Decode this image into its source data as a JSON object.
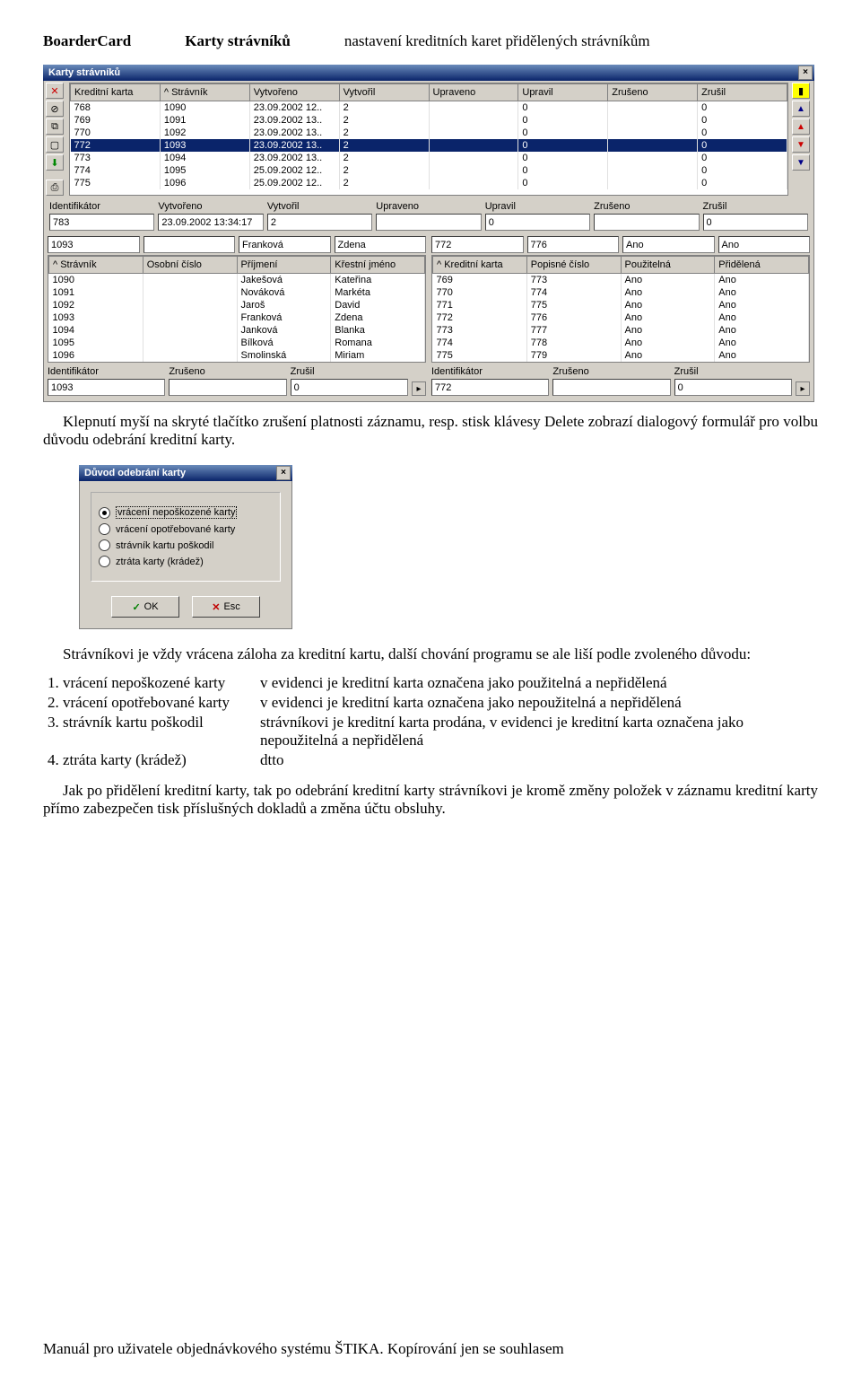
{
  "header": {
    "col1": "BoarderCard",
    "col2": "Karty strávníků",
    "col3": "nastavení kreditních karet přidělených strávníkům"
  },
  "mainWin": {
    "title": "Karty strávníků",
    "cols": [
      "Kreditní karta",
      "^ Strávník",
      "Vytvořeno",
      "Vytvořil",
      "Upraveno",
      "Upravil",
      "Zrušeno",
      "Zrušil"
    ],
    "rows": [
      [
        "768",
        "1090",
        "23.09.2002 12..",
        "2",
        "",
        "0",
        "",
        "0"
      ],
      [
        "769",
        "1091",
        "23.09.2002 13..",
        "2",
        "",
        "0",
        "",
        "0"
      ],
      [
        "770",
        "1092",
        "23.09.2002 13..",
        "2",
        "",
        "0",
        "",
        "0"
      ],
      [
        "772",
        "1093",
        "23.09.2002 13..",
        "2",
        "",
        "0",
        "",
        "0"
      ],
      [
        "773",
        "1094",
        "23.09.2002 13..",
        "2",
        "",
        "0",
        "",
        "0"
      ],
      [
        "774",
        "1095",
        "25.09.2002 12..",
        "2",
        "",
        "0",
        "",
        "0"
      ],
      [
        "775",
        "1096",
        "25.09.2002 12..",
        "2",
        "",
        "0",
        "",
        "0"
      ]
    ],
    "selIdx": 3,
    "form": {
      "labels": [
        "Identifikátor",
        "Vytvořeno",
        "Vytvořil",
        "Upraveno",
        "Upravil",
        "Zrušeno",
        "Zrušil"
      ],
      "vals": [
        "783",
        "23.09.2002 13:34:17",
        "2",
        "",
        "0",
        "",
        "0"
      ]
    },
    "left": {
      "top": [
        "1093",
        "",
        "Franková",
        "Zdena"
      ],
      "cols": [
        "^ Strávník",
        "Osobní číslo",
        "Příjmení",
        "Křestní jméno"
      ],
      "rows": [
        [
          "1090",
          "",
          "Jakešová",
          "Kateřina"
        ],
        [
          "1091",
          "",
          "Nováková",
          "Markéta"
        ],
        [
          "1092",
          "",
          "Jaroš",
          "David"
        ],
        [
          "1093",
          "",
          "Franková",
          "Zdena"
        ],
        [
          "1094",
          "",
          "Janková",
          "Blanka"
        ],
        [
          "1095",
          "",
          "Bílková",
          "Romana"
        ],
        [
          "1096",
          "",
          "Smolinská",
          "Miriam"
        ]
      ],
      "bottom": {
        "labels": [
          "Identifikátor",
          "Zrušeno",
          "Zrušil"
        ],
        "vals": [
          "1093",
          "",
          "0"
        ]
      }
    },
    "right": {
      "top": [
        "772",
        "776",
        "Ano",
        "Ano"
      ],
      "cols": [
        "^ Kreditní karta",
        "Popisné číslo",
        "Použitelná",
        "Přidělená"
      ],
      "rows": [
        [
          "769",
          "773",
          "Ano",
          "Ano"
        ],
        [
          "770",
          "774",
          "Ano",
          "Ano"
        ],
        [
          "771",
          "775",
          "Ano",
          "Ano"
        ],
        [
          "772",
          "776",
          "Ano",
          "Ano"
        ],
        [
          "773",
          "777",
          "Ano",
          "Ano"
        ],
        [
          "774",
          "778",
          "Ano",
          "Ano"
        ],
        [
          "775",
          "779",
          "Ano",
          "Ano"
        ]
      ],
      "bottom": {
        "labels": [
          "Identifikátor",
          "Zrušeno",
          "Zrušil"
        ],
        "vals": [
          "772",
          "",
          "0"
        ]
      }
    }
  },
  "para1": "Klepnutí myší na skryté tlačítko zrušení platnosti záznamu, resp. stisk klávesy Delete zobrazí dialogový formulář pro volbu důvodu odebrání kreditní karty.",
  "dialog": {
    "title": "Důvod odebrání karty",
    "options": [
      "vrácení nepoškozené karty",
      "vrácení opotřebované karty",
      "strávník kartu poškodil",
      "ztráta karty (krádež)"
    ],
    "ok": "OK",
    "esc": "Esc"
  },
  "para2": "Strávníkovi je vždy vrácena záloha za kreditní kartu, další chování programu se ale liší podle zvoleného důvodu:",
  "reasons": [
    {
      "k": "vrácení nepoškozené karty",
      "v": "v evidenci je kreditní karta označena jako použitelná a nepřidělená"
    },
    {
      "k": "vrácení opotřebované karty",
      "v": "v evidenci je kreditní karta označena jako nepoužitelná a nepřidělená"
    },
    {
      "k": "strávník kartu poškodil",
      "v": "strávníkovi je kreditní karta prodána, v evidenci je kreditní karta označena jako nepoužitelná a nepřidělená"
    },
    {
      "k": "ztráta karty (krádež)",
      "v": "dtto"
    }
  ],
  "para3": "Jak po přidělení kreditní karty, tak po odebrání kreditní karty strávníkovi je kromě změny položek v záznamu kreditní karty přímo zabezpečen tisk příslušných dokladů a změna účtu obsluhy.",
  "footer": "Manuál pro uživatele objednávkového systému ŠTIKA. Kopírování jen se souhlasem"
}
